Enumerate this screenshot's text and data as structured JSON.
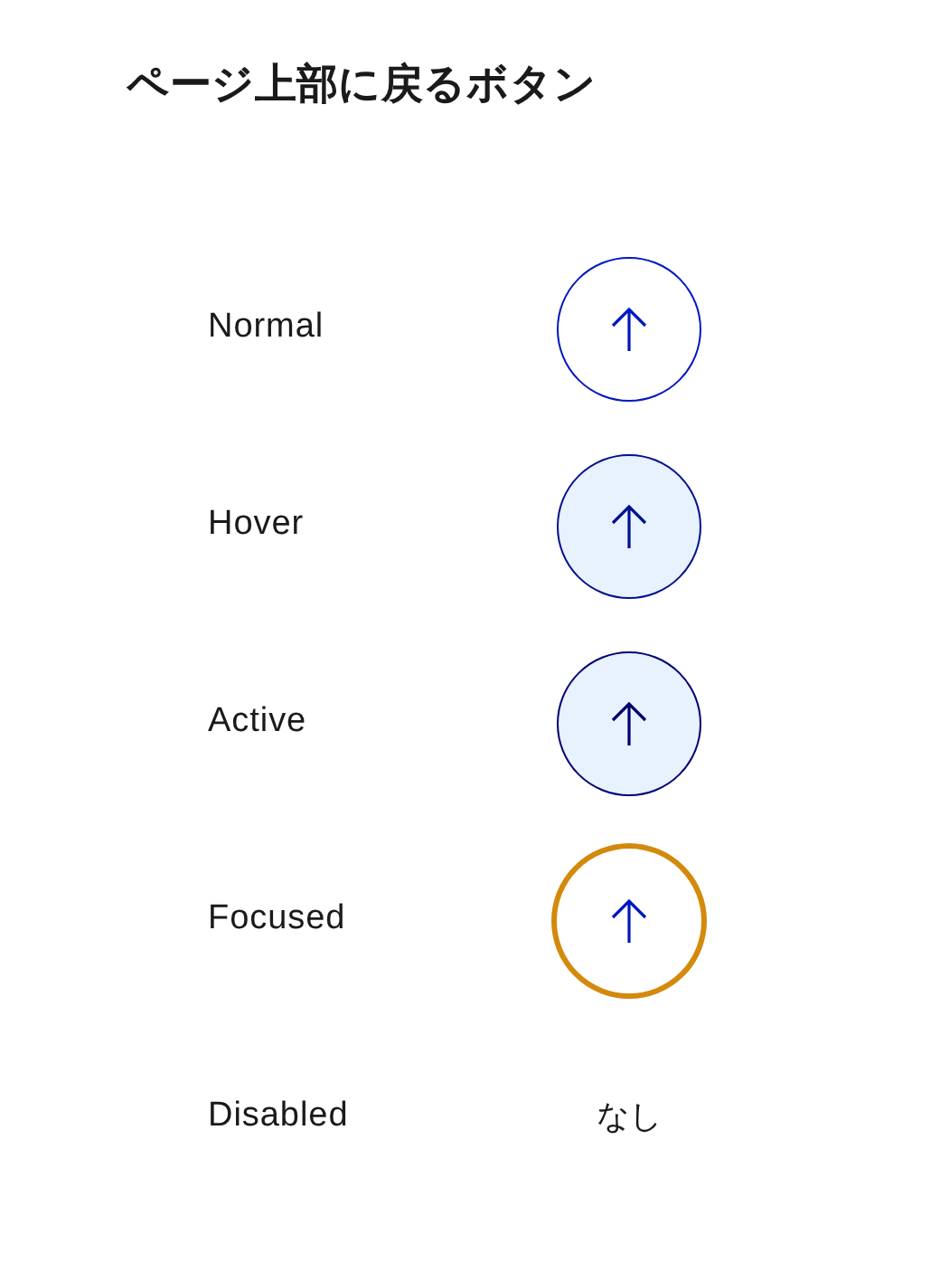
{
  "title": "ページ上部に戻るボタン",
  "rows": [
    {
      "label": "Normal",
      "kind": "normal"
    },
    {
      "label": "Hover",
      "kind": "hover"
    },
    {
      "label": "Active",
      "kind": "active"
    },
    {
      "label": "Focused",
      "kind": "focused"
    },
    {
      "label": "Disabled",
      "kind": "text",
      "text": "なし"
    }
  ]
}
